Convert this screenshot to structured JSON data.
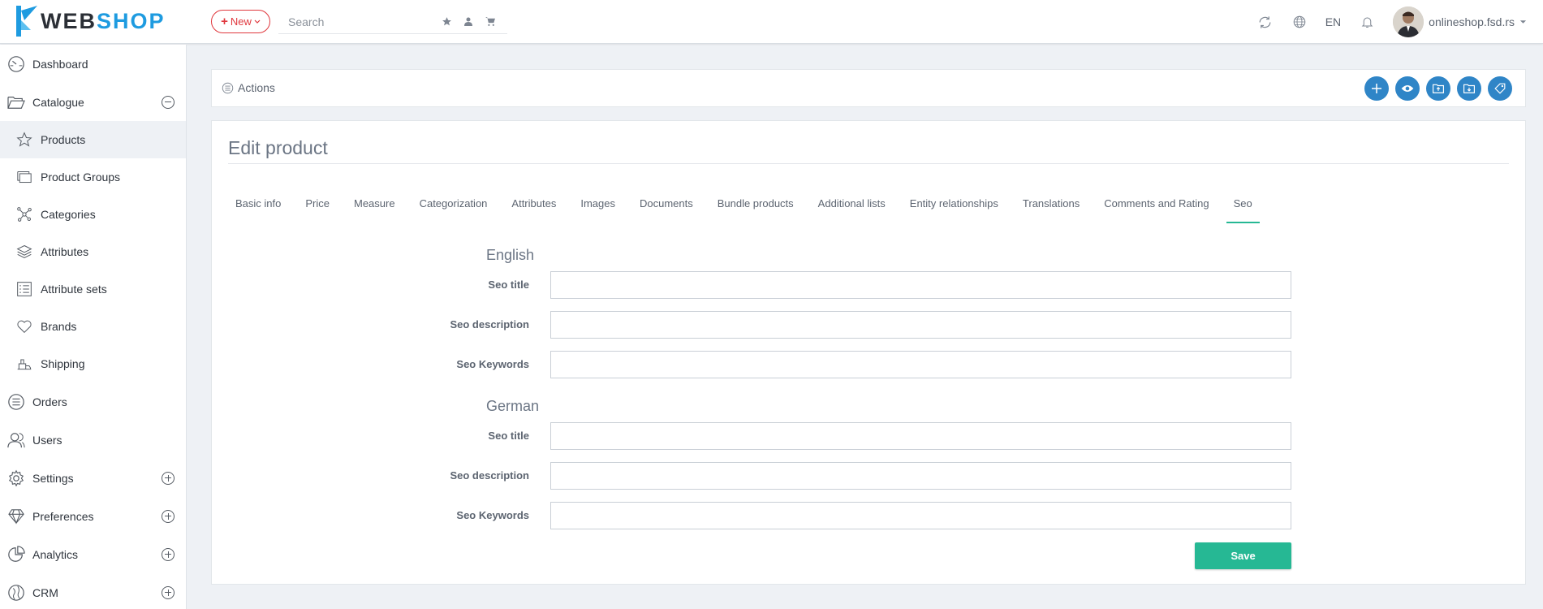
{
  "header": {
    "logo_web": "WEB",
    "logo_shop": "SHOP",
    "new_label": "New",
    "search_placeholder": "Search",
    "language": "EN",
    "user_name": "onlineshop.fsd.rs",
    "colors": {
      "brand": "#1e9be0",
      "new": "#e0383e"
    }
  },
  "sidebar": {
    "items": [
      {
        "label": "Dashboard",
        "icon": "dashboard-icon"
      },
      {
        "label": "Catalogue",
        "icon": "folder-open-icon",
        "expanded": true
      },
      {
        "label": "Products",
        "icon": "star-icon",
        "active": true
      },
      {
        "label": "Product Groups",
        "icon": "product-groups-icon"
      },
      {
        "label": "Categories",
        "icon": "categories-icon"
      },
      {
        "label": "Attributes",
        "icon": "layers-icon"
      },
      {
        "label": "Attribute sets",
        "icon": "list-icon"
      },
      {
        "label": "Brands",
        "icon": "heart-icon"
      },
      {
        "label": "Shipping",
        "icon": "shipping-icon"
      },
      {
        "label": "Orders",
        "icon": "orders-icon"
      },
      {
        "label": "Users",
        "icon": "users-icon"
      },
      {
        "label": "Settings",
        "icon": "gear-icon",
        "expanded": false
      },
      {
        "label": "Preferences",
        "icon": "diamond-icon",
        "expanded": false
      },
      {
        "label": "Analytics",
        "icon": "pie-chart-icon",
        "expanded": false
      },
      {
        "label": "CRM",
        "icon": "crm-icon",
        "expanded": false
      }
    ]
  },
  "actions": {
    "label": "Actions",
    "buttons": [
      "add-icon",
      "eye-icon",
      "folder-export-icon",
      "folder-import-icon",
      "tag-icon"
    ],
    "color": "#2f85c7"
  },
  "main": {
    "title": "Edit product",
    "tabs": [
      {
        "label": "Basic info"
      },
      {
        "label": "Price"
      },
      {
        "label": "Measure"
      },
      {
        "label": "Categorization"
      },
      {
        "label": "Attributes"
      },
      {
        "label": "Images"
      },
      {
        "label": "Documents"
      },
      {
        "label": "Bundle products"
      },
      {
        "label": "Additional lists"
      },
      {
        "label": "Entity relationships"
      },
      {
        "label": "Translations"
      },
      {
        "label": "Comments and Rating"
      },
      {
        "label": "Seo",
        "active": true
      }
    ],
    "languages": [
      {
        "name": "English",
        "fields": [
          {
            "label": "Seo title",
            "value": ""
          },
          {
            "label": "Seo description",
            "value": ""
          },
          {
            "label": "Seo Keywords",
            "value": ""
          }
        ]
      },
      {
        "name": "German",
        "fields": [
          {
            "label": "Seo title",
            "value": ""
          },
          {
            "label": "Seo description",
            "value": ""
          },
          {
            "label": "Seo Keywords",
            "value": ""
          }
        ]
      }
    ],
    "save_label": "Save",
    "accent": "#26b894"
  }
}
